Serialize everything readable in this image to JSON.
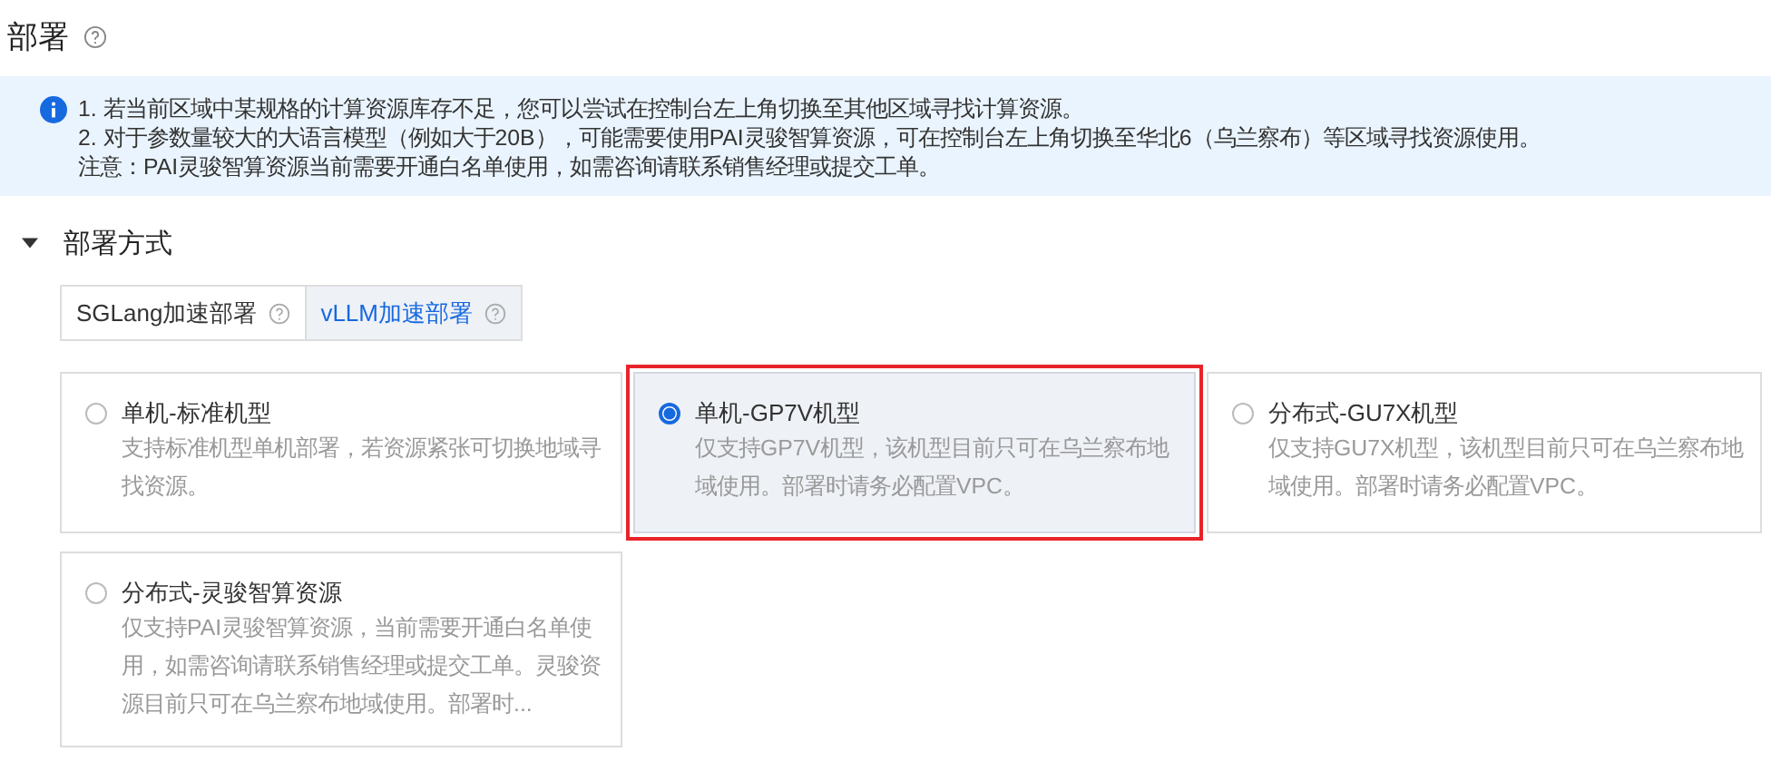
{
  "title": "部署",
  "notice": {
    "lines": [
      "1. 若当前区域中某规格的计算资源库存不足，您可以尝试在控制台左上角切换至其他区域寻找计算资源。",
      "2. 对于参数量较大的大语言模型（例如大于20B），可能需要使用PAI灵骏智算资源，可在控制台左上角切换至华北6（乌兰察布）等区域寻找资源使用。",
      "注意：PAI灵骏智算资源当前需要开通白名单使用，如需咨询请联系销售经理或提交工单。"
    ]
  },
  "section": {
    "title": "部署方式",
    "expanded": true
  },
  "tabs": [
    {
      "label": "SGLang加速部署",
      "selected": false
    },
    {
      "label": "vLLM加速部署",
      "selected": true
    }
  ],
  "options": [
    {
      "title": "单机-标准机型",
      "description": "支持标准机型单机部署，若资源紧张可切换地域寻找资源。",
      "selected": false,
      "highlighted": false
    },
    {
      "title": "单机-GP7V机型",
      "description": "仅支持GP7V机型，该机型目前只可在乌兰察布地域使用。部署时请务必配置VPC。",
      "selected": true,
      "highlighted": true
    },
    {
      "title": "分布式-GU7X机型",
      "description": "仅支持GU7X机型，该机型目前只可在乌兰察布地域使用。部署时请务必配置VPC。",
      "selected": false,
      "highlighted": false
    },
    {
      "title": "分布式-灵骏智算资源",
      "description": "仅支持PAI灵骏智算资源，当前需要开通白名单使用，如需咨询请联系销售经理或提交工单。灵骏资源目前只可在乌兰察布地域使用。部署时...",
      "selected": false,
      "highlighted": false
    }
  ]
}
